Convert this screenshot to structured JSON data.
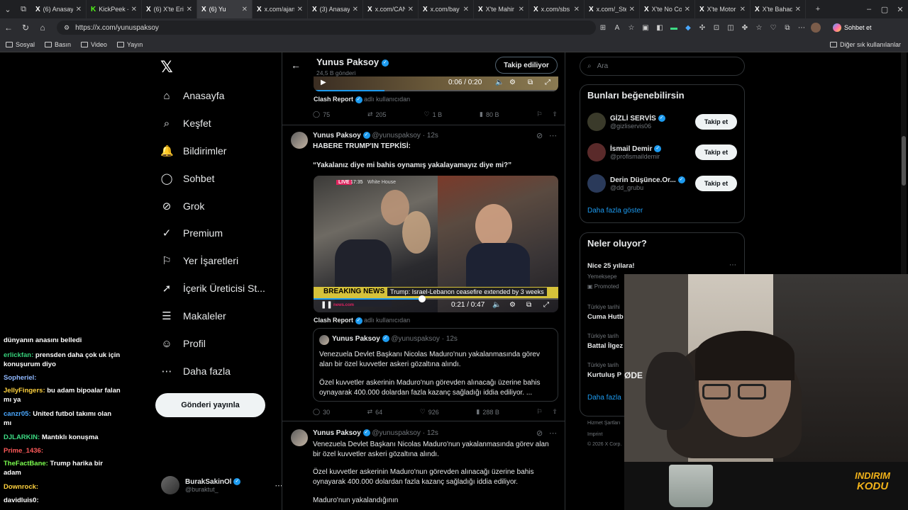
{
  "browser": {
    "tabs": [
      {
        "fav": "X",
        "title": "(6) Anasayf"
      },
      {
        "fav": "K",
        "title": "KickPeek -"
      },
      {
        "fav": "X",
        "title": "(6) X'te Eri"
      },
      {
        "fav": "X",
        "title": "(6) Yu"
      },
      {
        "fav": "X",
        "title": "x.com/ajan"
      },
      {
        "fav": "X",
        "title": "(3) Anasay"
      },
      {
        "fav": "X",
        "title": "x.com/CAN"
      },
      {
        "fav": "X",
        "title": "x.com/bay"
      },
      {
        "fav": "X",
        "title": "X'te Mahir"
      },
      {
        "fav": "X",
        "title": "x.com/sbs"
      },
      {
        "fav": "X",
        "title": "x.com/_Ste"
      },
      {
        "fav": "X",
        "title": "X'te No Co"
      },
      {
        "fav": "X",
        "title": "X'te Motor"
      },
      {
        "fav": "X",
        "title": "X'te Bahad"
      }
    ],
    "url": "https://x.com/yunuspaksoy",
    "sohbet": "Sohbet et",
    "bookmarks": [
      "Sosyal",
      "Basın",
      "Video",
      "Yayın"
    ],
    "other_bookmarks": "Diğer sık kullanılanlar"
  },
  "nav": {
    "items": [
      {
        "icon": "home-icon",
        "label": "Anasayfa"
      },
      {
        "icon": "search-icon",
        "label": "Keşfet"
      },
      {
        "icon": "bell-icon",
        "label": "Bildirimler"
      },
      {
        "icon": "chat-icon",
        "label": "Sohbet"
      },
      {
        "icon": "grok-icon",
        "label": "Grok"
      },
      {
        "icon": "premium-icon",
        "label": "Premium"
      },
      {
        "icon": "bookmark-icon",
        "label": "Yer İşaretleri"
      },
      {
        "icon": "rocket-icon",
        "label": "İçerik Üreticisi St..."
      },
      {
        "icon": "article-icon",
        "label": "Makaleler"
      },
      {
        "icon": "user-icon",
        "label": "Profil"
      },
      {
        "icon": "more-icon",
        "label": "Daha fazla"
      }
    ],
    "post_button": "Gönderi yayınla",
    "account": {
      "name": "BurakSakinOl",
      "handle": "@buraktut_"
    }
  },
  "chat": [
    {
      "user": "",
      "text": "dünyanın anasını belledi",
      "color": "#ffffff"
    },
    {
      "user": "erlickfan:",
      "text": "prensden daha çok uk için konuşurum diyo",
      "color": "#36d07a"
    },
    {
      "user": "Sopheriel:",
      "text": "",
      "color": "#8fb8ff"
    },
    {
      "user": "JellyFingers:",
      "text": "bu adam bipoalar falan mı ya",
      "color": "#ffd23f"
    },
    {
      "user": "canzr05:",
      "text": "United futbol takımı olan mı",
      "color": "#4aa8ff"
    },
    {
      "user": "DJLARKIN:",
      "text": "Mantıklı konuşma",
      "color": "#3ddc84"
    },
    {
      "user": "Prime_1436:",
      "text": "",
      "color": "#ff5a5a"
    },
    {
      "user": "TheFactBane:",
      "text": "Trump harika bir adam",
      "color": "#7cff4f"
    },
    {
      "user": "Downrock:",
      "text": "",
      "color": "#ffd23f"
    },
    {
      "user": "davidluis0:",
      "text": "",
      "color": "#ffffff"
    }
  ],
  "profile": {
    "name": "Yunus Paksoy",
    "posts": "24,5 B gönderi",
    "following_button": "Takip ediliyor"
  },
  "top_video": {
    "time": "0:06 / 0:20",
    "caption": "Clash Report",
    "via": "adlı kullanıcıdan"
  },
  "top_actions": {
    "replies": "75",
    "reposts": "205",
    "likes": "1 B",
    "views": "80 B"
  },
  "tweet1": {
    "name": "Yunus Paksoy",
    "handle": "@yunuspaksoy",
    "time": "12s",
    "line1": "HABERE TRUMP'IN TEPKİSİ:",
    "line2": "“Yakalanız diye mi bahis oynamış yakalayamayız diye mi?”",
    "video": {
      "live": "LIVE",
      "clock": "17:35",
      "place": "White House",
      "breaking": "BREAKING NEWS",
      "ticker": "Trump: Israel-Lebanon ceasefire extended by 3 weeks",
      "time": "0:21 / 0:47",
      "news": "news.com"
    },
    "caption": "Clash Report",
    "via": "adlı kullanıcıdan",
    "quote": {
      "name": "Yunus Paksoy",
      "handle": "@yunuspaksoy",
      "time": "12s",
      "p1": "Venezuela Devlet Başkanı Nicolas Maduro'nun yakalanmasında görev alan bir özel kuvvetler askeri gözaltına alındı.",
      "p2": "Özel kuvvetler askerinin Maduro'nun görevden alınacağı üzerine bahis oynayarak 400.000 dolardan fazla kazanç sağladığı iddia ediliyor. ..."
    },
    "actions": {
      "replies": "30",
      "reposts": "64",
      "likes": "926",
      "views": "288 B"
    }
  },
  "tweet2": {
    "name": "Yunus Paksoy",
    "handle": "@yunuspaksoy",
    "time": "12s",
    "p1": "Venezuela Devlet Başkanı Nicolas Maduro'nun yakalanmasında görev alan bir özel kuvvetler askeri gözaltına alındı.",
    "p2": "Özel kuvvetler askerinin Maduro'nun görevden alınacağı üzerine bahis oynayarak 400.000 dolardan fazla kazanç sağladığı iddia ediliyor.",
    "p3": "Maduro'nun yakalandığının"
  },
  "right": {
    "search_placeholder": "Ara",
    "suggest_title": "Bunları beğenebilirsin",
    "suggestions": [
      {
        "name": "GİZLİ SERVİS",
        "handle": "@gizliservis06",
        "button": "Takip et"
      },
      {
        "name": "İsmail Demir",
        "handle": "@profismaildemir",
        "button": "Takip et"
      },
      {
        "name": "Derin Düşünce.Or...",
        "handle": "@dd_grubu",
        "button": "Takip et"
      }
    ],
    "show_more": "Daha fazla göster",
    "trends_title": "Neler oluyor?",
    "trends": [
      {
        "sub": "",
        "title": "Nice 25 yıllara!"
      },
      {
        "sub": "Yemeksepe",
        "title": ""
      },
      {
        "sub": "Promoted",
        "title": ""
      },
      {
        "sub": "Türkiye tarihi",
        "title": "Cuma Hutb"
      },
      {
        "sub": "Türkiye tarih",
        "title": "Battal İlgez"
      },
      {
        "sub": "Türkiye tarih",
        "title": "Kurtuluş P"
      }
    ],
    "trends_more": "Daha fazla",
    "footer1": "Hizmet Şartları",
    "footer2": "Imprint",
    "footer3": "© 2026 X Corp."
  },
  "stream": {
    "logo_line1": "INDIRIM",
    "logo_line2": "KODU",
    "cam_text": "ØDE"
  }
}
